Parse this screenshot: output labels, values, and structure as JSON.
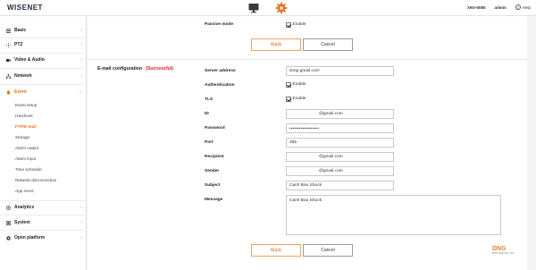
{
  "header": {
    "logo": "WISENET",
    "model": "XNV-6085",
    "user": "admin",
    "help_label": "Help",
    "icons": [
      "monitor-icon",
      "gear-icon",
      "help-icon"
    ],
    "accent_color": "#e8701a"
  },
  "sidebar": {
    "groups": [
      {
        "label": "Basic",
        "icon": "list-icon"
      },
      {
        "label": "PTZ",
        "icon": "ptz-move-icon"
      },
      {
        "label": "Video & Audio",
        "icon": "video-icon"
      },
      {
        "label": "Network",
        "icon": "network-icon"
      },
      {
        "label": "Event",
        "icon": "bell-icon",
        "active": true
      },
      {
        "label": "Analytics",
        "icon": "analytics-icon"
      },
      {
        "label": "System",
        "icon": "system-icon"
      },
      {
        "label": "Open platform",
        "icon": "platform-icon"
      }
    ],
    "event_items": [
      "Event setup",
      "Handover",
      "FTP/E-mail",
      "Storage",
      "Alarm output",
      "Alarm input",
      "Time schedule",
      "Network disconnection",
      "App event"
    ],
    "active_item": "FTP/E-mail"
  },
  "ftp_section": {
    "passive_mode_label": "Passive mode",
    "passive_mode_check_label": "Enable",
    "apply_label": "Apply",
    "cancel_label": "Cancel"
  },
  "email_section": {
    "title": "E-mail configuration",
    "status": "(Successful)",
    "status_color": "#e01b1b",
    "fields": {
      "server_address_label": "Server address",
      "server_address_value": "smtp.gmail.com",
      "authentication_label": "Authentication",
      "authentication_check_label": "Enable",
      "tls_label": "TLS",
      "tls_check_label": "Enable",
      "id_label": "ID",
      "id_value": "@gmail.com",
      "password_label": "Password",
      "password_value": "••••••••••••••••••",
      "port_label": "Port",
      "port_value": "465",
      "recipient_label": "Recipient",
      "recipient_value": "@gmail.com",
      "sender_label": "Sender",
      "sender_value": "@gmail.com",
      "subject_label": "Subject",
      "subject_value": "Canh Bao Shock",
      "message_label": "Message",
      "message_value": "Canh Bao Shock"
    },
    "apply_label": "Apply",
    "cancel_label": "Cancel"
  },
  "watermark": {
    "text": "DNG",
    "subtext": "DNG DIGITAL JSC"
  }
}
